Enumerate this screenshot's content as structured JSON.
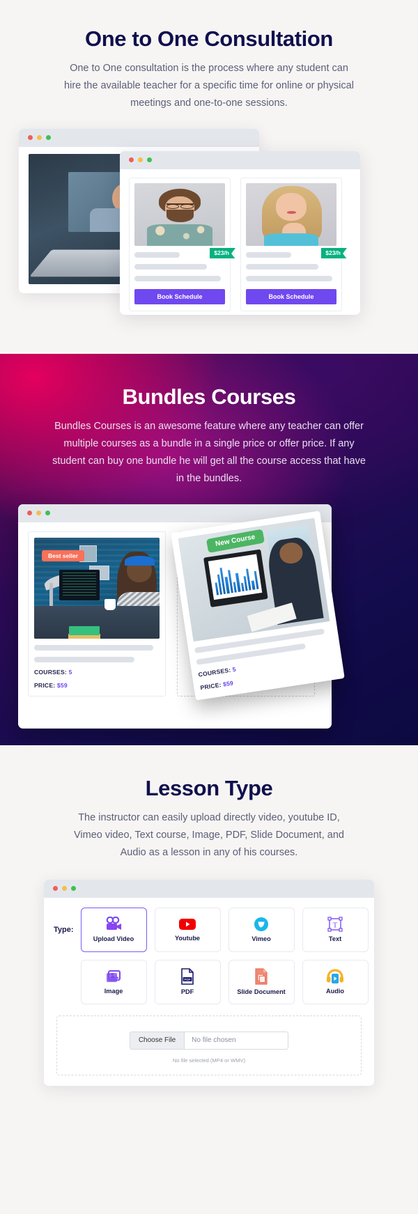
{
  "sections": {
    "consultation": {
      "title": "One to One Consultation",
      "description": "One to One consultation is the process where any student can hire the available teacher for a specific time for online or physical meetings and one-to-one sessions.",
      "teacher_cards": [
        {
          "price_badge": "$23/h",
          "button_label": "Book Schedule",
          "photo": "bearded-man-glasses-portrait"
        },
        {
          "price_badge": "$23/h",
          "button_label": "Book Schedule",
          "photo": "blonde-woman-portrait"
        }
      ],
      "background_photo": "video-call-on-laptop"
    },
    "bundles": {
      "title": "Bundles Courses",
      "description": "Bundles Courses is an awesome feature where any teacher can offer multiple courses as a bundle in a single price or offer price. If any student can buy one bundle he will get all the course access that have in the bundles.",
      "cards": [
        {
          "badge": "Best seller",
          "courses_label": "COURSES:",
          "courses_value": "5",
          "price_label": "PRICE:",
          "price_value": "$59",
          "photo": "student-with-headphones-at-desk"
        },
        {
          "badge": "New Course",
          "courses_label": "COURSES:",
          "courses_value": "5",
          "price_label": "PRICE:",
          "price_value": "$59",
          "photo": "man-reviewing-chart-on-monitor"
        }
      ]
    },
    "lesson_type": {
      "title": "Lesson Type",
      "description": "The instructor can easily upload directly video, youtube ID, Vimeo video, Text course, Image, PDF, Slide Document, and Audio as a lesson in any of his courses.",
      "type_label": "Type:",
      "tiles": [
        {
          "label": "Upload Video",
          "icon": "video-camera-icon",
          "selected": true
        },
        {
          "label": "Youtube",
          "icon": "youtube-icon",
          "selected": false
        },
        {
          "label": "Vimeo",
          "icon": "vimeo-icon",
          "selected": false
        },
        {
          "label": "Text",
          "icon": "text-box-icon",
          "selected": false
        },
        {
          "label": "Image",
          "icon": "image-icon",
          "selected": false
        },
        {
          "label": "PDF",
          "icon": "pdf-file-icon",
          "selected": false
        },
        {
          "label": "Slide Document",
          "icon": "slide-document-icon",
          "selected": false
        },
        {
          "label": "Audio",
          "icon": "headphones-icon",
          "selected": false
        }
      ],
      "upload": {
        "choose_button": "Choose File",
        "file_status": "No file chosen",
        "hint": "No file selected (MP4 or WMV)"
      }
    }
  },
  "colors": {
    "heading_navy": "#10104e",
    "accent_purple": "#7048f0",
    "price_green": "#05b17f",
    "bestseller_orange": "#fa7059",
    "newcourse_green": "#4cb563",
    "page_bg": "#f7f5f3"
  },
  "window_dots": [
    "red",
    "yellow",
    "green"
  ]
}
